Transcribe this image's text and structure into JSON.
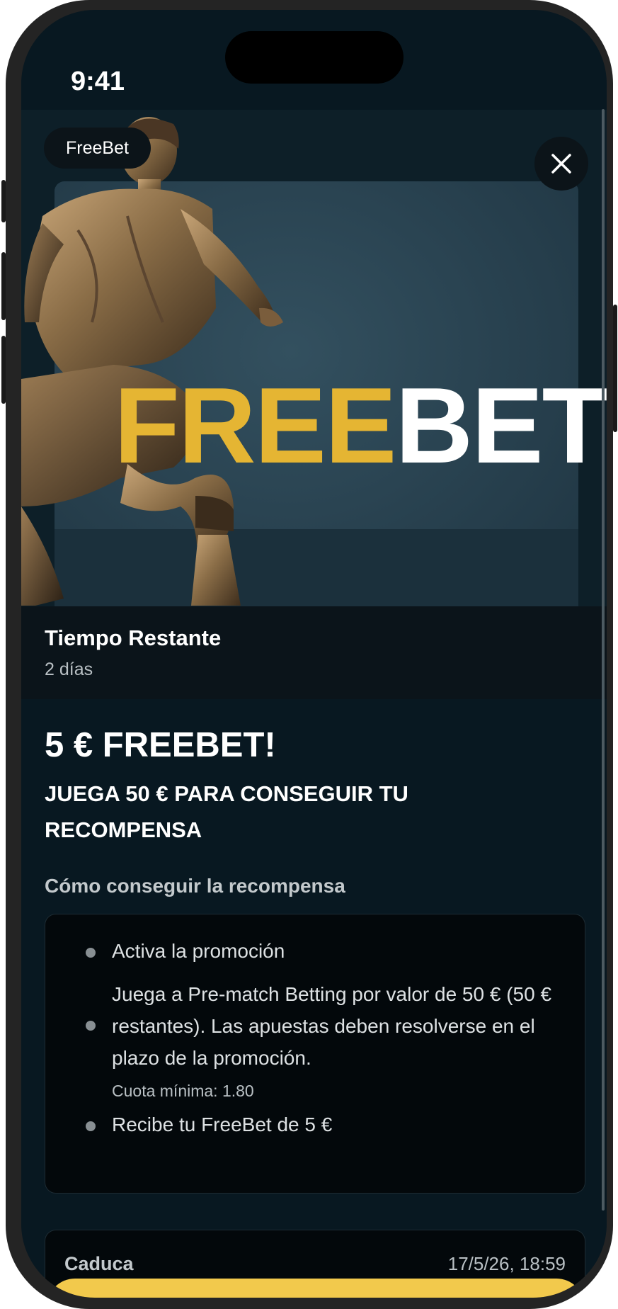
{
  "status_bar": {
    "time": "9:41"
  },
  "hero": {
    "chip_label": "FreeBet",
    "banner_word_highlight": "FREE",
    "banner_word_rest": "BET",
    "close_icon": "close-icon",
    "remaining_label": "Tiempo Restante",
    "remaining_value": "2 días"
  },
  "promo": {
    "title": "5 € FREEBET!",
    "subtitle": "JUEGA 50 € PARA CONSEGUIR TU RECOMPENSA",
    "how_title": "Cómo conseguir la recompensa",
    "steps": [
      {
        "text": "Activa la promoción"
      },
      {
        "text": "Juega a Pre-match Betting por valor de 50 € (50 € restantes). Las apuestas deben resolverse en el plazo de la promoción.",
        "note": "Cuota mínima: 1.80"
      },
      {
        "text": "Recibe tu FreeBet de 5 €"
      }
    ]
  },
  "expiry": {
    "label": "Caduca",
    "value": "17/5/26, 18:59"
  },
  "colors": {
    "accent": "#e5b533",
    "cta": "#f2c94c",
    "background": "#081821"
  }
}
